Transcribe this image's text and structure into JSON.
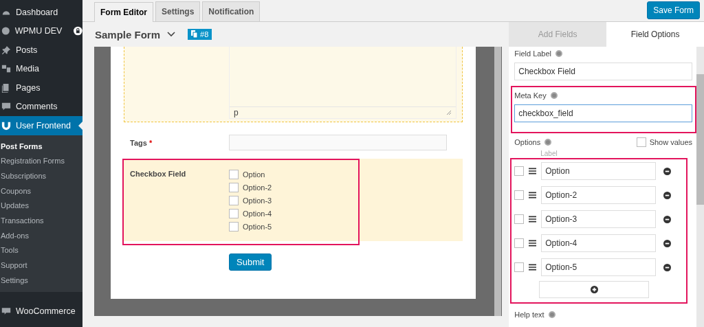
{
  "sidebar": {
    "items": [
      {
        "label": "Dashboard",
        "selected": false,
        "locked": false
      },
      {
        "label": "WPMU DEV",
        "selected": false,
        "locked": true
      },
      {
        "label": "Posts",
        "selected": false,
        "locked": false
      },
      {
        "label": "Media",
        "selected": false,
        "locked": false
      },
      {
        "label": "Pages",
        "selected": false,
        "locked": false
      },
      {
        "label": "Comments",
        "selected": false,
        "locked": false
      },
      {
        "label": "User Frontend",
        "selected": true,
        "locked": false
      }
    ],
    "submenu": [
      {
        "label": "Post Forms",
        "selected": true
      },
      {
        "label": "Registration Forms",
        "selected": false
      },
      {
        "label": "Subscriptions",
        "selected": false
      },
      {
        "label": "Coupons",
        "selected": false
      },
      {
        "label": "Updates",
        "selected": false
      },
      {
        "label": "Transactions",
        "selected": false
      },
      {
        "label": "Add-ons",
        "selected": false
      },
      {
        "label": "Tools",
        "selected": false
      },
      {
        "label": "Support",
        "selected": false
      },
      {
        "label": "Settings",
        "selected": false
      }
    ],
    "bottom_items": [
      {
        "label": "WooCommerce",
        "selected": false
      }
    ]
  },
  "tabs": [
    {
      "label": "Form Editor",
      "selected": true
    },
    {
      "label": "Settings",
      "selected": false
    },
    {
      "label": "Notification",
      "selected": false
    }
  ],
  "save_button": "Save Form",
  "form": {
    "title": "Sample Form",
    "id_badge": "#8"
  },
  "preview": {
    "editor_status": "p",
    "tags": {
      "label": "Tags",
      "required": "*"
    },
    "checkbox_field": {
      "label": "Checkbox Field",
      "options": [
        {
          "label": "Option",
          "checked": false
        },
        {
          "label": "Option-2",
          "checked": false
        },
        {
          "label": "Option-3",
          "checked": false
        },
        {
          "label": "Option-4",
          "checked": false
        },
        {
          "label": "Option-5",
          "checked": false
        }
      ]
    },
    "submit": "Submit"
  },
  "panel": {
    "tabs": [
      {
        "label": "Add Fields",
        "selected": false
      },
      {
        "label": "Field Options",
        "selected": true
      }
    ],
    "field_label": {
      "label": "Field Label",
      "value": "Checkbox Field"
    },
    "meta_key": {
      "label": "Meta Key",
      "value": "checkbox_field"
    },
    "options": {
      "label": "Options",
      "show_values": {
        "label": "Show values",
        "checked": false
      },
      "column": "Label",
      "rows": [
        {
          "value": "Option",
          "checked": false
        },
        {
          "value": "Option-2",
          "checked": false
        },
        {
          "value": "Option-3",
          "checked": false
        },
        {
          "value": "Option-4",
          "checked": false
        },
        {
          "value": "Option-5",
          "checked": false
        }
      ]
    },
    "help_text": {
      "label": "Help text"
    }
  }
}
